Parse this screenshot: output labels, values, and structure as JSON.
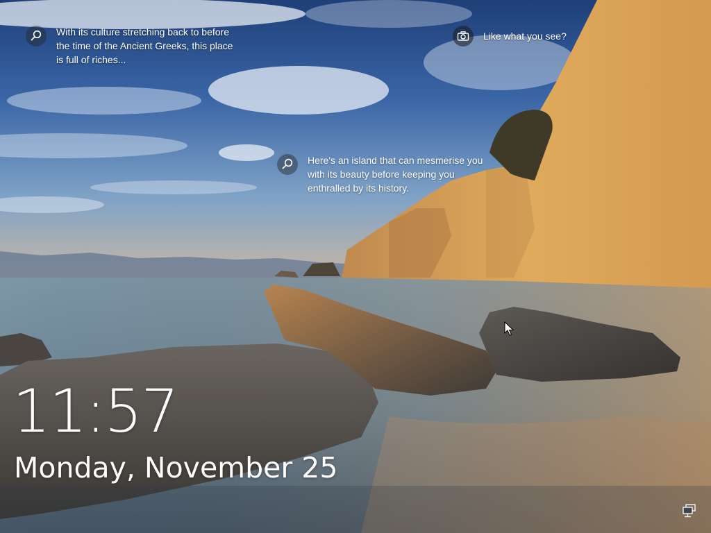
{
  "lockscreen": {
    "hotspots": [
      {
        "icon": "search-icon",
        "text": "With its culture stretching back to before\nthe time of the Ancient Greeks, this place\nis full of riches..."
      },
      {
        "icon": "search-icon",
        "text": "Here's an island that can mesmerise you\nwith its beauty before keeping you\nenthralled by its history."
      }
    ],
    "like_prompt": {
      "icon": "camera-icon",
      "text": "Like what you see?"
    },
    "time": "11:57",
    "date": "Monday, November 25",
    "network_icon": "network-icon",
    "cursor_icon": "mouse-pointer-icon"
  },
  "colors": {
    "text": "#ffffff",
    "sky": "#2a4d85",
    "cliff": "#d9a45a",
    "sea": "#5f7f93"
  }
}
